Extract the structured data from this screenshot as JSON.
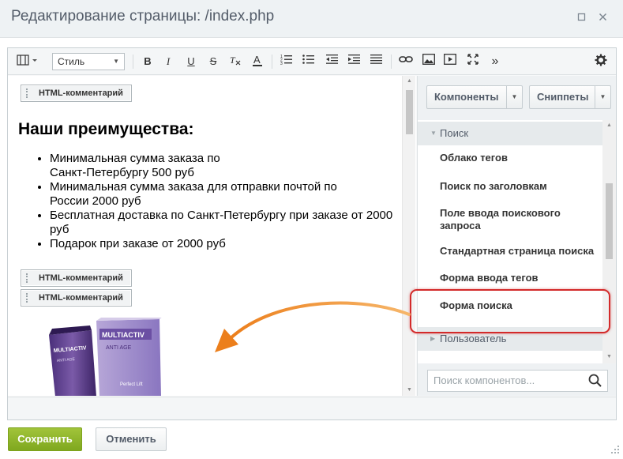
{
  "dialog": {
    "title": "Редактирование страницы: /index.php",
    "maximize_icon": "maximize-icon",
    "close_icon": "close-icon"
  },
  "toolbar": {
    "style_label": "Стиль",
    "icons": [
      "view-mode-icon",
      "bold-icon",
      "italic-icon",
      "underline-icon",
      "strikethrough-icon",
      "remove-format-icon",
      "font-color-icon",
      "ordered-list-icon",
      "unordered-list-icon",
      "outdent-icon",
      "indent-icon",
      "justify-icon",
      "link-icon",
      "image-icon",
      "video-icon",
      "fullscreen-icon",
      "more-icon",
      "settings-icon"
    ],
    "bold_glyph": "B",
    "italic_glyph": "I",
    "underline_glyph": "U",
    "strike_glyph": "S",
    "more_glyph": "»"
  },
  "content": {
    "comment_label": "HTML-комментарий",
    "heading": "Наши преимущества:",
    "bullets": [
      "Минимальная сумма заказа по Санкт-Петербургу 500 руб",
      "Минимальная сумма заказа для отправки почтой по России 2000 руб",
      "Бесплатная доставка по Санкт-Петербургу при заказе от 2000 руб",
      "Подарок при заказе от 2000 руб"
    ],
    "product_brand": "MULTIACTIV",
    "product_line": "ANTI AGE",
    "product_sub": "Perfect Lift"
  },
  "sidebar": {
    "components_label": "Компоненты",
    "snippets_label": "Сниппеты",
    "group_search": "Поиск",
    "items": [
      "Облако тегов",
      "Поиск по заголовкам",
      "Поле ввода поискового запроса",
      "Стандартная страница поиска",
      "Форма ввода тегов",
      "Форма поиска"
    ],
    "group_user": "Пользователь",
    "search_placeholder": "Поиск компонентов..."
  },
  "footer": {
    "save_label": "Сохранить",
    "cancel_label": "Отменить"
  },
  "colors": {
    "accent_green": "#8cb42a",
    "highlight_red": "#d32a2a",
    "arrow_orange": "#f0922e"
  }
}
